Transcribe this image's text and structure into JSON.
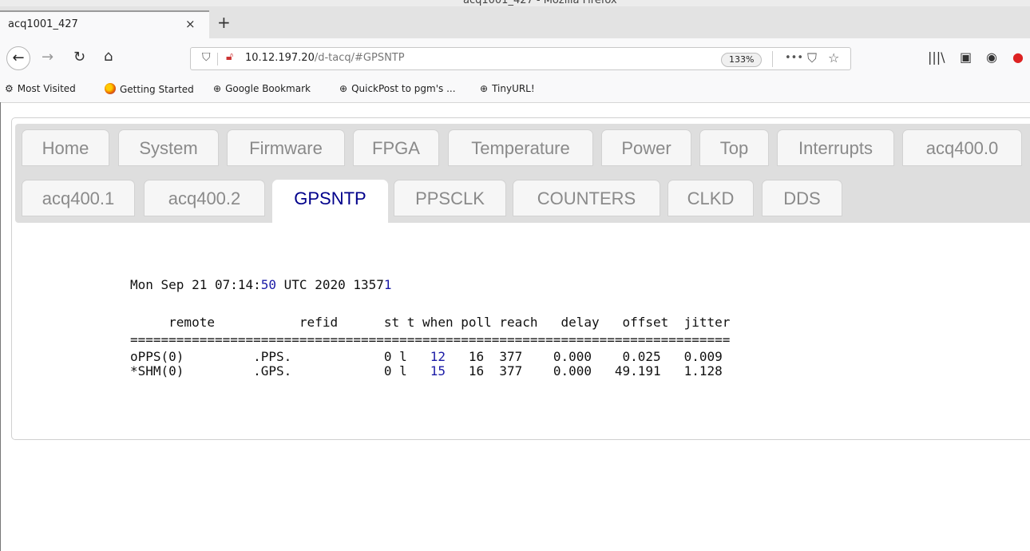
{
  "window": {
    "title": "acq1001_427 - Mozilla Firefox"
  },
  "browser": {
    "tab_title": "acq1001_427",
    "tab_close": "×",
    "new_tab": "+",
    "url_host": "10.12.197.20",
    "url_path": "/d-tacq/#GPSNTP",
    "zoom": "133%",
    "page_actions": "•••"
  },
  "bookmarks": [
    {
      "label": "Most Visited",
      "icon": "gear-icon"
    },
    {
      "label": "Getting Started",
      "icon": "firefox-icon"
    },
    {
      "label": "Google Bookmark",
      "icon": "globe-icon"
    },
    {
      "label": "QuickPost to pgm's ...",
      "icon": "globe-icon"
    },
    {
      "label": "TinyURL!",
      "icon": "globe-icon"
    }
  ],
  "page_tabs": {
    "row1": [
      "Home",
      "System",
      "Firmware",
      "FPGA",
      "Temperature",
      "Power",
      "Top",
      "Interrupts",
      "acq400.0"
    ],
    "row2": [
      "acq400.1",
      "acq400.2",
      "GPSNTP",
      "PPSCLK",
      "COUNTERS",
      "CLKD",
      "DDS"
    ],
    "active": "GPSNTP"
  },
  "ntp": {
    "date_prefix": "Mon Sep 21 07:14:",
    "date_seconds": "50",
    "date_middle": " UTC 2020 1357",
    "date_last": "1",
    "header": "     remote           refid      st t when poll reach   delay   offset  jitter",
    "separator": "==============================================================================",
    "rows": [
      {
        "pre": "oPPS(0)         .PPS.            0 l   ",
        "when": "12",
        "post": "   16  377    0.000    0.025   0.009"
      },
      {
        "pre": "*SHM(0)         .GPS.            0 l   ",
        "when": "15",
        "post": "   16  377    0.000   49.191   1.128"
      }
    ]
  },
  "colors": {
    "active_tab_text": "#00008b",
    "highlight": "#1a1aa6",
    "tab_text": "#8a8a8a"
  }
}
